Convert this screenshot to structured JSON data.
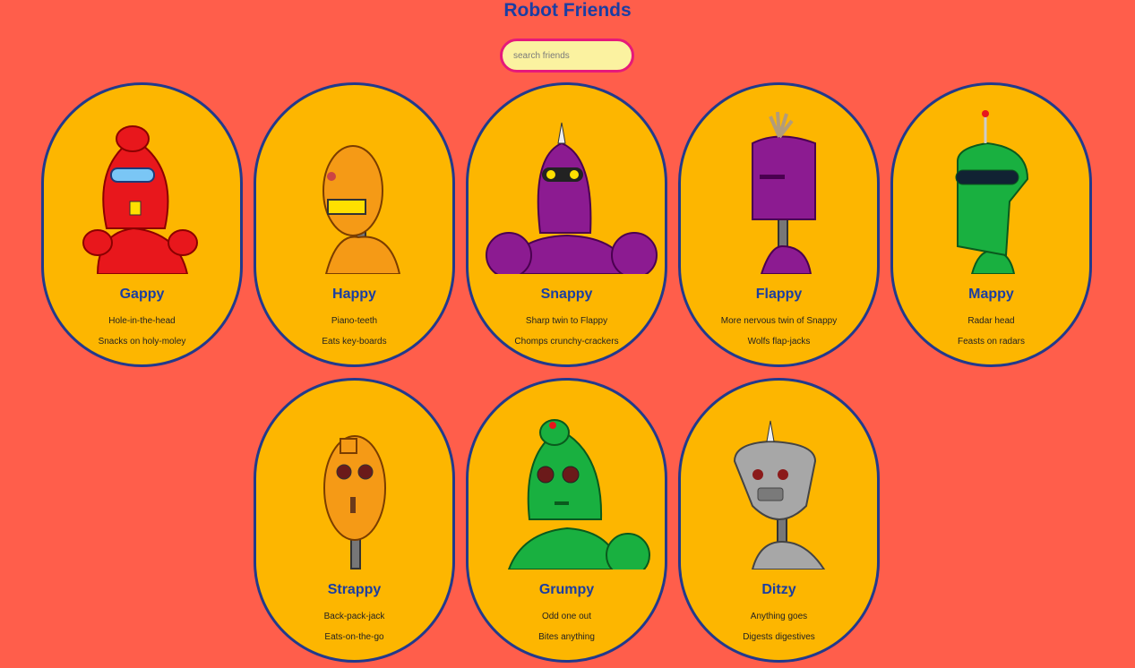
{
  "header": {
    "title": "Robot Friends"
  },
  "search": {
    "placeholder": "search friends",
    "value": ""
  },
  "robots": [
    {
      "name": "Gappy",
      "line1": "Hole-in-the-head",
      "line2": "Snacks on holy-moley",
      "color": "#e8171c"
    },
    {
      "name": "Happy",
      "line1": "Piano-teeth",
      "line2": "Eats key-boards",
      "color": "#f59a16"
    },
    {
      "name": "Snappy",
      "line1": "Sharp twin to Flappy",
      "line2": "Chomps crunchy-crackers",
      "color": "#8c1b91"
    },
    {
      "name": "Flappy",
      "line1": "More nervous twin of Snappy",
      "line2": "Wolfs flap-jacks",
      "color": "#8c1b91"
    },
    {
      "name": "Mappy",
      "line1": "Radar head",
      "line2": "Feasts on radars",
      "color": "#19b040"
    },
    {
      "name": "Strappy",
      "line1": "Back-pack-jack",
      "line2": "Eats-on-the-go",
      "color": "#f59a16"
    },
    {
      "name": "Grumpy",
      "line1": "Odd one out",
      "line2": "Bites anything",
      "color": "#19b040"
    },
    {
      "name": "Ditzy",
      "line1": "Anything goes",
      "line2": "Digests digestives",
      "color": "#a7a7a7"
    }
  ]
}
